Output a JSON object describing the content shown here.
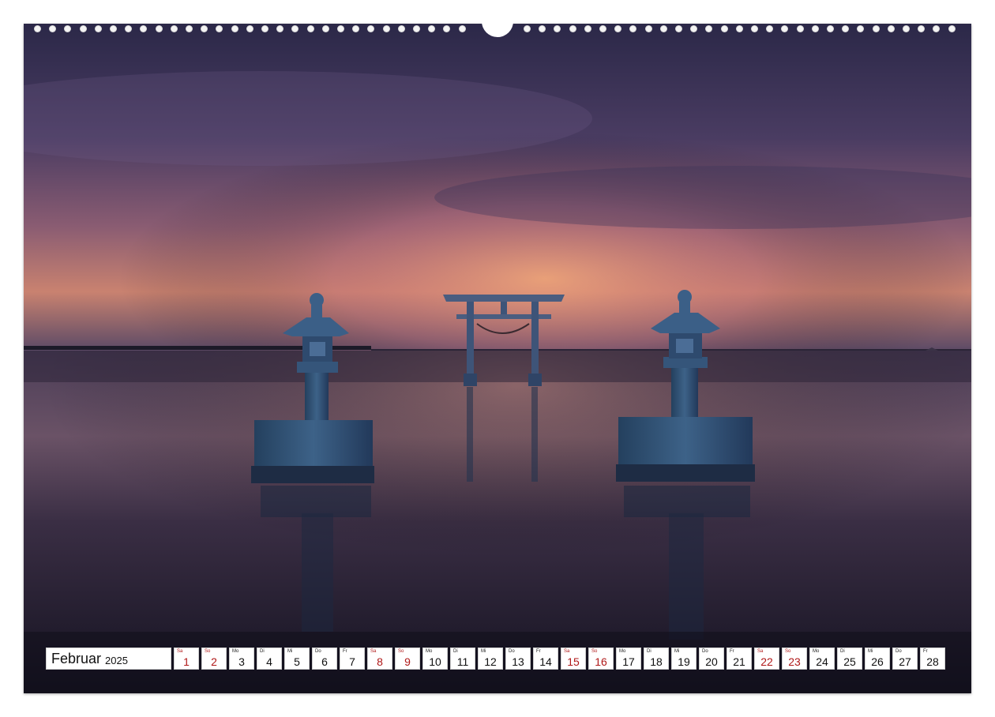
{
  "calendar": {
    "month": "Februar",
    "year": "2025",
    "weekend_color": "#b01818",
    "days": [
      {
        "dow": "Sa",
        "num": "1",
        "weekend": true
      },
      {
        "dow": "So",
        "num": "2",
        "weekend": true
      },
      {
        "dow": "Mo",
        "num": "3",
        "weekend": false
      },
      {
        "dow": "Di",
        "num": "4",
        "weekend": false
      },
      {
        "dow": "Mi",
        "num": "5",
        "weekend": false
      },
      {
        "dow": "Do",
        "num": "6",
        "weekend": false
      },
      {
        "dow": "Fr",
        "num": "7",
        "weekend": false
      },
      {
        "dow": "Sa",
        "num": "8",
        "weekend": true
      },
      {
        "dow": "So",
        "num": "9",
        "weekend": true
      },
      {
        "dow": "Mo",
        "num": "10",
        "weekend": false
      },
      {
        "dow": "Di",
        "num": "11",
        "weekend": false
      },
      {
        "dow": "Mi",
        "num": "12",
        "weekend": false
      },
      {
        "dow": "Do",
        "num": "13",
        "weekend": false
      },
      {
        "dow": "Fr",
        "num": "14",
        "weekend": false
      },
      {
        "dow": "Sa",
        "num": "15",
        "weekend": true
      },
      {
        "dow": "So",
        "num": "16",
        "weekend": true
      },
      {
        "dow": "Mo",
        "num": "17",
        "weekend": false
      },
      {
        "dow": "Di",
        "num": "18",
        "weekend": false
      },
      {
        "dow": "Mi",
        "num": "19",
        "weekend": false
      },
      {
        "dow": "Do",
        "num": "20",
        "weekend": false
      },
      {
        "dow": "Fr",
        "num": "21",
        "weekend": false
      },
      {
        "dow": "Sa",
        "num": "22",
        "weekend": true
      },
      {
        "dow": "So",
        "num": "23",
        "weekend": true
      },
      {
        "dow": "Mo",
        "num": "24",
        "weekend": false
      },
      {
        "dow": "Di",
        "num": "25",
        "weekend": false
      },
      {
        "dow": "Mi",
        "num": "26",
        "weekend": false
      },
      {
        "dow": "Do",
        "num": "27",
        "weekend": false
      },
      {
        "dow": "Fr",
        "num": "28",
        "weekend": false
      }
    ]
  },
  "photo": {
    "subject": "torii-gate-and-stone-lanterns-in-water-at-dusk-photo",
    "colors": {
      "sky_top": "#2e2a4a",
      "sky_glow": "#d08a6c",
      "water": "#1e1a2c",
      "stone": "#2f4a66"
    }
  }
}
